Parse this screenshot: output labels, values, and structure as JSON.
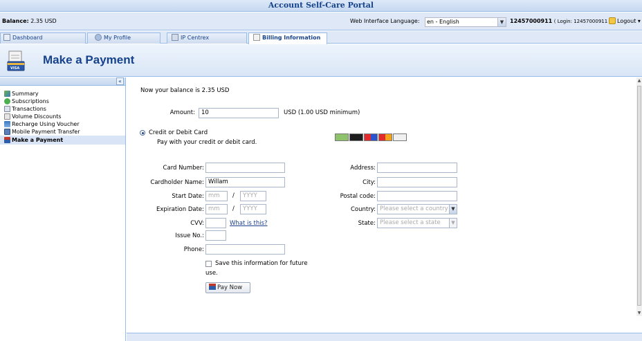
{
  "app": {
    "title": "Account Self-Care Portal"
  },
  "header": {
    "balance_label": "Balance:",
    "balance_value": "2.35 USD",
    "language_label": "Web Interface Language:",
    "language_value": "en - English",
    "account_id": "12457000911",
    "login_text": "( Login: 12457000911 )",
    "logout_label": "Logout"
  },
  "tabs": [
    {
      "label": "Dashboard",
      "icon": "dashboard-icon",
      "active": false
    },
    {
      "label": "My Profile",
      "icon": "user-icon",
      "active": false
    },
    {
      "label": "IP Centrex",
      "icon": "network-icon",
      "active": false
    },
    {
      "label": "Billing Information",
      "icon": "document-icon",
      "active": true
    }
  ],
  "page": {
    "title": "Make a Payment"
  },
  "sidebar": {
    "collapse_symbol": "«",
    "items": [
      {
        "label": "Summary",
        "icon": "chart-icon",
        "active": false
      },
      {
        "label": "Subscriptions",
        "icon": "refresh-icon",
        "active": false
      },
      {
        "label": "Transactions",
        "icon": "list-icon",
        "active": false
      },
      {
        "label": "Volume Discounts",
        "icon": "discount-icon",
        "active": false
      },
      {
        "label": "Recharge Using Voucher",
        "icon": "voucher-icon",
        "active": false
      },
      {
        "label": "Mobile Payment Transfer",
        "icon": "mobile-icon",
        "active": false
      },
      {
        "label": "Make a Payment",
        "icon": "payment-icon",
        "active": true
      }
    ]
  },
  "form": {
    "balance_text": "Now your balance is 2.35 USD",
    "amount_label": "Amount:",
    "amount_value": "10",
    "amount_hint": "USD (1.00 USD minimum)",
    "method_label": "Credit or Debit Card",
    "method_desc": "Pay with your credit or debit card.",
    "card_number_label": "Card Number:",
    "card_number_value": "",
    "cardholder_label": "Cardholder Name:",
    "cardholder_value": "Willam",
    "start_date_label": "Start Date:",
    "expiration_label": "Expiration Date:",
    "month_placeholder": "mm",
    "year_placeholder": "YYYY",
    "date_separator": "/",
    "cvv_label": "CVV:",
    "cvv_help_link": "What is this?",
    "issue_label": "Issue No.:",
    "phone_label": "Phone:",
    "address_label": "Address:",
    "city_label": "City:",
    "postal_label": "Postal code:",
    "country_label": "Country:",
    "country_placeholder": "Please select a country",
    "state_label": "State:",
    "state_placeholder": "Please select a state",
    "save_label_line1": "Save this information for future",
    "save_label_line2": "use.",
    "save_checked": false,
    "pay_button": "Pay Now"
  },
  "colors": {
    "accent": "#15428b",
    "panel_bg": "#dfe8f6",
    "border": "#99bbe8"
  }
}
